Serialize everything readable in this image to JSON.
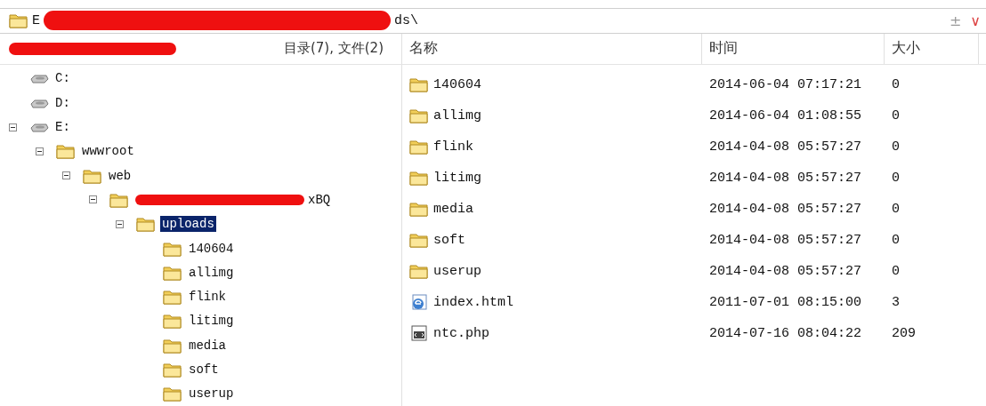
{
  "path_bar": {
    "path_start": "E",
    "path_end": "ds\\",
    "redacted": true,
    "buttons": [
      "±",
      "∨"
    ]
  },
  "tree_header": {
    "redacted": true,
    "summary": "目录(7), 文件(2)"
  },
  "columns": [
    "名称",
    "时间",
    "大小"
  ],
  "tree": [
    {
      "label": "C:",
      "kind": "drive",
      "selected": false
    },
    {
      "label": "D:",
      "kind": "drive",
      "selected": false
    },
    {
      "label": "E:",
      "kind": "drive",
      "selected": false,
      "expanded": true,
      "children": [
        {
          "label": "wwwroot",
          "kind": "folder",
          "selected": false,
          "expanded": true,
          "children": [
            {
              "label": "web",
              "kind": "folder",
              "selected": false,
              "expanded": true,
              "children": [
                {
                  "label": "xBQ",
                  "kind": "folder",
                  "redacted": true,
                  "selected": false,
                  "expanded": true,
                  "children": [
                    {
                      "label": "uploads",
                      "kind": "folder",
                      "selected": true,
                      "expanded": true,
                      "children": [
                        {
                          "label": "140604",
                          "kind": "folder",
                          "selected": false
                        },
                        {
                          "label": "allimg",
                          "kind": "folder",
                          "selected": false
                        },
                        {
                          "label": "flink",
                          "kind": "folder",
                          "selected": false
                        },
                        {
                          "label": "litimg",
                          "kind": "folder",
                          "selected": false
                        },
                        {
                          "label": "media",
                          "kind": "folder",
                          "selected": false
                        },
                        {
                          "label": "soft",
                          "kind": "folder",
                          "selected": false
                        },
                        {
                          "label": "userup",
                          "kind": "folder",
                          "selected": false
                        }
                      ]
                    }
                  ]
                }
              ]
            }
          ]
        }
      ]
    }
  ],
  "files": [
    {
      "name": "140604",
      "kind": "folder",
      "time": "2014-06-04 07:17:21",
      "size": "0"
    },
    {
      "name": "allimg",
      "kind": "folder",
      "time": "2014-06-04 01:08:55",
      "size": "0"
    },
    {
      "name": "flink",
      "kind": "folder",
      "time": "2014-04-08 05:57:27",
      "size": "0"
    },
    {
      "name": "litimg",
      "kind": "folder",
      "time": "2014-04-08 05:57:27",
      "size": "0"
    },
    {
      "name": "media",
      "kind": "folder",
      "time": "2014-04-08 05:57:27",
      "size": "0"
    },
    {
      "name": "soft",
      "kind": "folder",
      "time": "2014-04-08 05:57:27",
      "size": "0"
    },
    {
      "name": "userup",
      "kind": "folder",
      "time": "2014-04-08 05:57:27",
      "size": "0"
    },
    {
      "name": "index.html",
      "kind": "html",
      "time": "2011-07-01 08:15:00",
      "size": "3"
    },
    {
      "name": "ntc.php",
      "kind": "script",
      "time": "2014-07-16 08:04:22",
      "size": "209"
    }
  ]
}
